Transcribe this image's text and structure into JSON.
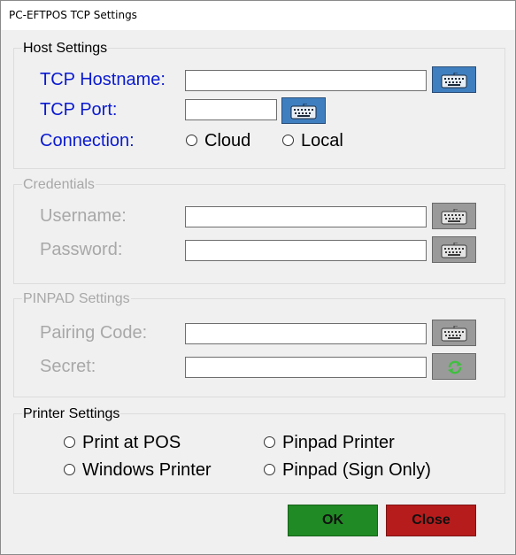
{
  "window": {
    "title": "PC-EFTPOS TCP Settings"
  },
  "host": {
    "legend": "Host Settings",
    "hostname_label": "TCP Hostname:",
    "hostname_value": "",
    "port_label": "TCP Port:",
    "port_value": "",
    "connection_label": "Connection:",
    "options": [
      "Cloud",
      "Local"
    ]
  },
  "credentials": {
    "legend": "Credentials",
    "username_label": "Username:",
    "username_value": "",
    "password_label": "Password:",
    "password_value": ""
  },
  "pinpad": {
    "legend": "PINPAD Settings",
    "pairing_label": "Pairing Code:",
    "pairing_value": "",
    "secret_label": "Secret:",
    "secret_value": ""
  },
  "printer": {
    "legend": "Printer Settings",
    "options": [
      "Print at POS",
      "Pinpad Printer",
      "Windows Printer",
      "Pinpad (Sign Only)"
    ]
  },
  "buttons": {
    "ok": "OK",
    "close": "Close"
  },
  "colors": {
    "label_blue": "#0a1ad0",
    "disabled": "#a8a8a8",
    "ok": "#208a24",
    "close": "#b71c1c",
    "keyboard_active": "#3f7fc0",
    "keyboard_disabled": "#9a9a9a"
  },
  "icons": {
    "keyboard": "keyboard-icon",
    "refresh": "refresh-icon"
  }
}
